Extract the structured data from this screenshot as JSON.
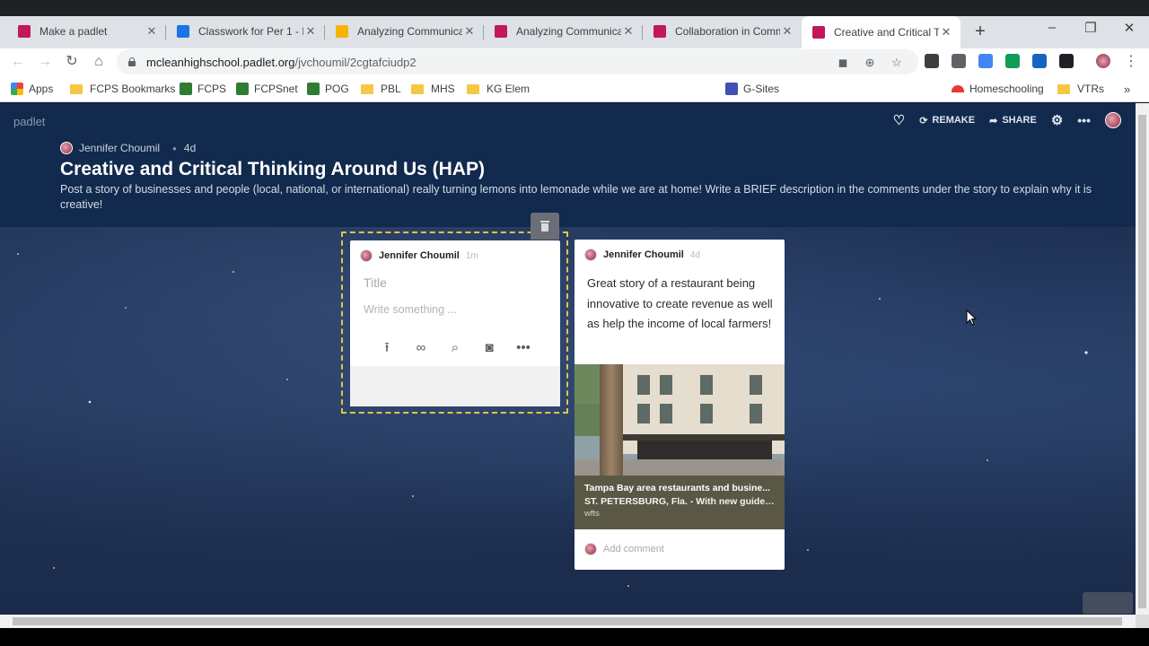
{
  "browser": {
    "tabs": [
      {
        "title": "Make a padlet",
        "color": "#c2185b"
      },
      {
        "title": "Classwork for Per 1 - H",
        "color": "#1a73e8"
      },
      {
        "title": "Analyzing Communicati",
        "color": "#f4b400"
      },
      {
        "title": "Analyzing Communicati",
        "color": "#c2185b"
      },
      {
        "title": "Collaboration in Comm",
        "color": "#c2185b"
      },
      {
        "title": "Creative and Critical Th",
        "color": "#c2185b"
      }
    ],
    "new_tab": "+",
    "url_host": "mcleanhighschool.padlet.org",
    "url_path": "/jvchoumil/2cgtafciudp2"
  },
  "bookmarks": [
    {
      "label": "Apps",
      "kind": "apps"
    },
    {
      "label": "FCPS Bookmarks",
      "kind": "folder"
    },
    {
      "label": "FCPS",
      "kind": "site",
      "color": "#2e7d32"
    },
    {
      "label": "FCPSnet",
      "kind": "site",
      "color": "#2e7d32"
    },
    {
      "label": "POG",
      "kind": "site",
      "color": "#2e7d32"
    },
    {
      "label": "PBL",
      "kind": "folder"
    },
    {
      "label": "MHS",
      "kind": "folder"
    },
    {
      "label": "KG Elem",
      "kind": "folder"
    },
    {
      "label": "G-Sites",
      "kind": "site",
      "color": "#3f51b5"
    },
    {
      "label": "Homeschooling",
      "kind": "site",
      "color": "#e53935"
    },
    {
      "label": "VTRs",
      "kind": "folder"
    }
  ],
  "padlet": {
    "brand": "padlet",
    "actions": {
      "remake": "REMAKE",
      "share": "SHARE"
    },
    "author": "Jennifer Choumil",
    "age": "4d",
    "title": "Creative and Critical Thinking Around Us (HAP)",
    "description": "Post a story of businesses and people (local, national, or international) really turning lemons into lemonade while we are at home! Write a BRIEF description in the comments under the story to explain why it is creative!"
  },
  "composer": {
    "author": "Jennifer Choumil",
    "time": "1m",
    "title_placeholder": "Title",
    "body_placeholder": "Write something ..."
  },
  "post": {
    "author": "Jennifer Choumil",
    "time": "4d",
    "body": "Great story of a restaurant being innovative to create revenue as well as help the income of local farmers!",
    "link_title": "Tampa Bay area restaurants and busine...",
    "link_desc": "ST. PETERSBURG, Fla. - With new guideli...",
    "link_source": "wfts",
    "comment_placeholder": "Add comment"
  }
}
